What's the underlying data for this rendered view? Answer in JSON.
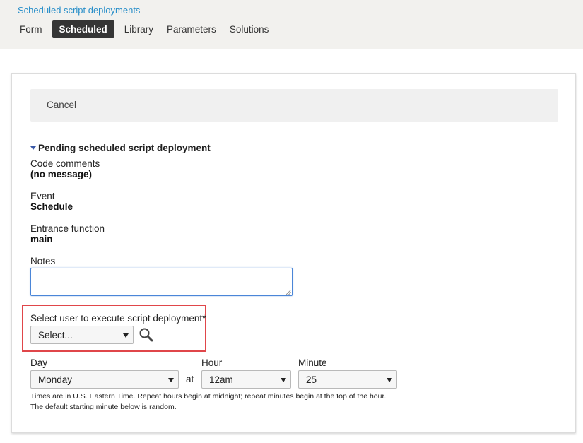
{
  "header": {
    "breadcrumb": "Scheduled script deployments",
    "tabs": [
      "Form",
      "Scheduled",
      "Library",
      "Parameters",
      "Solutions"
    ],
    "active_tab": "Scheduled"
  },
  "actions": {
    "cancel_label": "Cancel"
  },
  "section": {
    "title": "Pending scheduled script deployment",
    "fields": [
      {
        "label": "Code comments",
        "value": "(no message)"
      },
      {
        "label": "Event",
        "value": "Schedule"
      },
      {
        "label": "Entrance function",
        "value": "main"
      }
    ]
  },
  "notes": {
    "label": "Notes",
    "value": ""
  },
  "user_select": {
    "label": "Select user to execute script deployment*",
    "selected": "Select..."
  },
  "schedule": {
    "day_label": "Day",
    "day_value": "Monday",
    "at_label": "at",
    "hour_label": "Hour",
    "hour_value": "12am",
    "minute_label": "Minute",
    "minute_value": "25",
    "note_line1": "Times are in U.S. Eastern Time. Repeat hours begin at midnight; repeat minutes begin at the top of the hour.",
    "note_line2": "The default starting minute below is random."
  },
  "colors": {
    "accent_link": "#2a8fc9",
    "active_tab_bg": "#353535",
    "highlight": "#e0464a",
    "focus_border": "#4b86d8"
  }
}
